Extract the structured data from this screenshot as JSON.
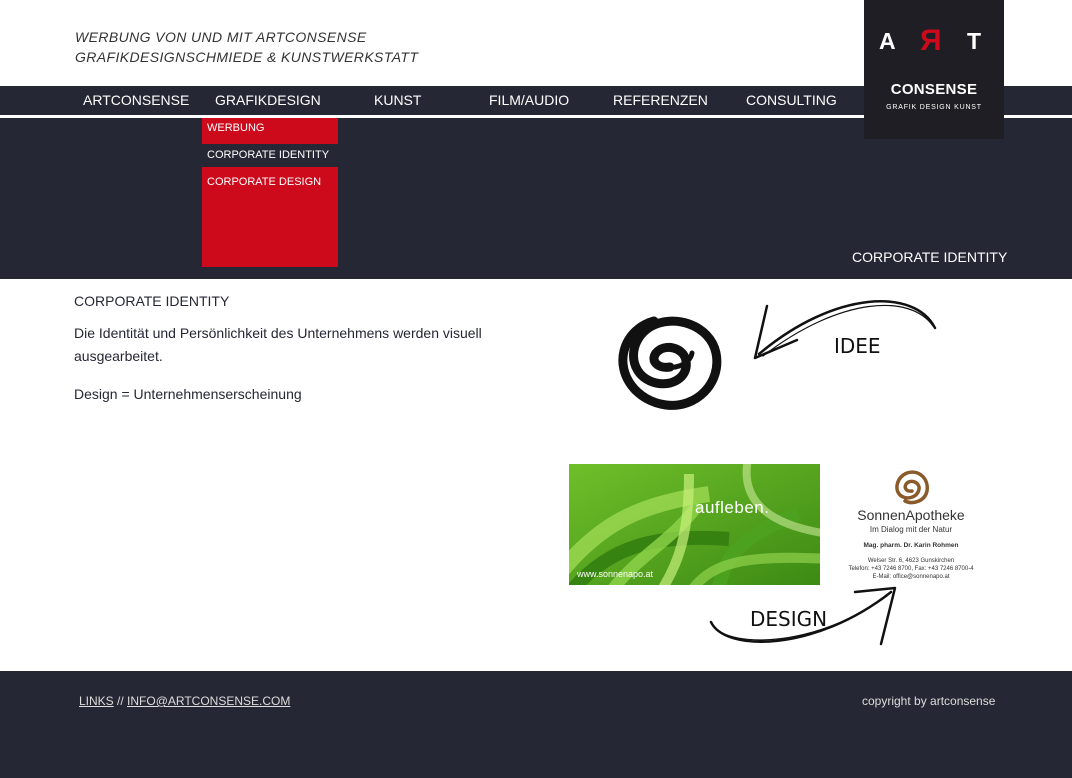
{
  "header": {
    "tagline_line1": "WERBUNG VON UND MIT ARTCONSENSE",
    "tagline_line2": "GRAFIKDESIGNSCHMIEDE & KUNSTWERKSTATT"
  },
  "logo": {
    "letter_a": "A",
    "letter_r": "R",
    "letter_t": "T",
    "brand": "CONSENSE",
    "subtitle": "GRAFIK  DESIGN  KUNST",
    "accent_color": "#cc0a1c"
  },
  "nav": {
    "items": [
      {
        "label": "ARTCONSENSE"
      },
      {
        "label": "GRAFIKDESIGN"
      },
      {
        "label": "KUNST"
      },
      {
        "label": "FILM/AUDIO"
      },
      {
        "label": "REFERENZEN"
      },
      {
        "label": "CONSULTING"
      }
    ],
    "submenu": [
      {
        "label": "WERBUNG"
      },
      {
        "label": "CORPORATE IDENTITY",
        "active": true
      },
      {
        "label": "CORPORATE DESIGN"
      }
    ],
    "bar_color": "#262734",
    "submenu_color": "#cc0a1c"
  },
  "hero": {
    "title": "CORPORATE IDENTITY"
  },
  "content": {
    "title": "CORPORATE IDENTITY",
    "paragraph1": "Die Identität und Persönlichkeit des Unternehmens werden visuell ausgearbeitet.",
    "paragraph2": "Design = Unternehmenserscheinung"
  },
  "illustration": {
    "idee_label": "IDEE",
    "design_label": "DESIGN",
    "green_slogan": "aufleben.",
    "green_url": "www.sonnenapo.at",
    "sonnen_name_part1": "Sonnen",
    "sonnen_name_part2": "Apotheke",
    "sonnen_tagline": "Im Dialog mit der Natur",
    "sonnen_person": "Mag. pharm. Dr. Karin Rohmen",
    "sonnen_address": "Welser Str. 6, 4623 Gunskirchen",
    "sonnen_phone": "Telefon: +43 7246 8700, Fax: +43 7246 8700-4",
    "sonnen_email": "E-Mail: office@sonnenapo.at"
  },
  "footer": {
    "links_label": "LINKS",
    "separator": " // ",
    "email": "INFO@ARTCONSENSE.COM",
    "copyright": "copyright by artconsense"
  }
}
